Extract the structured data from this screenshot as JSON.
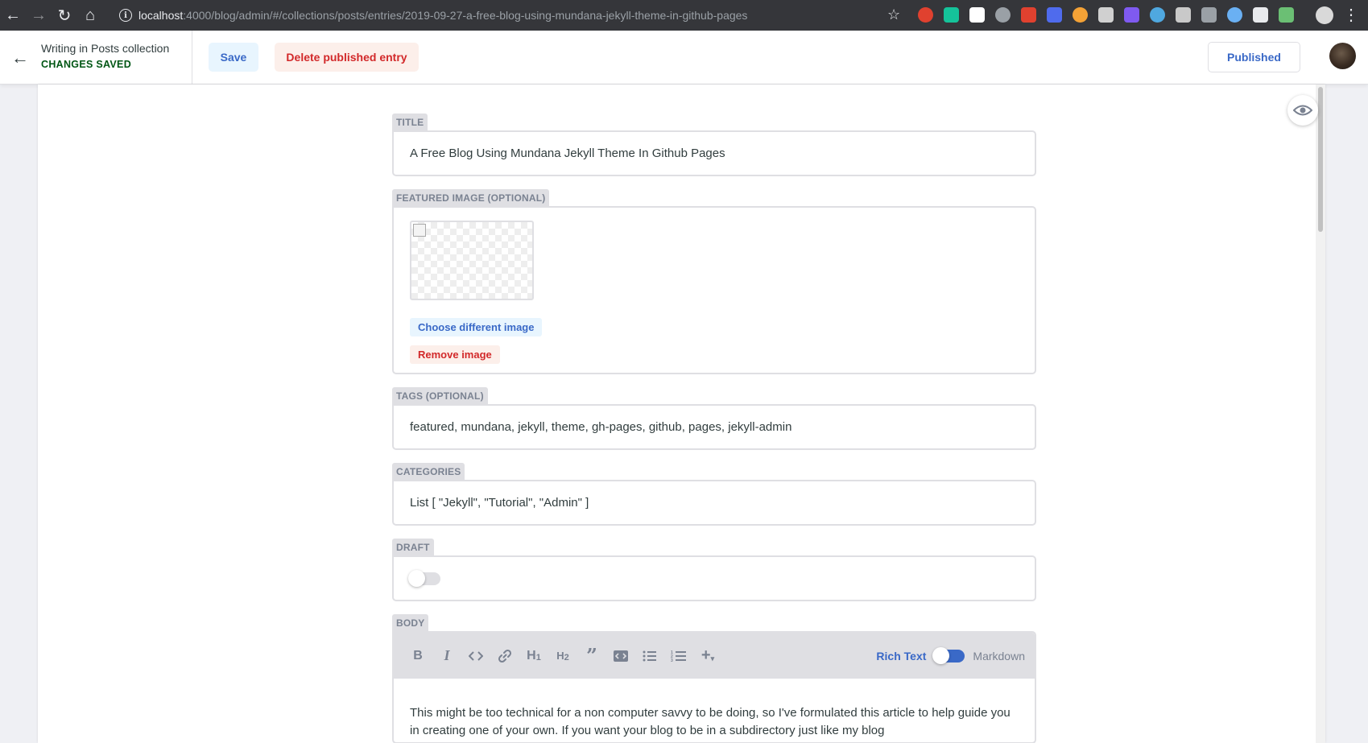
{
  "browser": {
    "url_host": "localhost",
    "url_path": ":4000/blog/admin/#/collections/posts/entries/2019-09-27-a-free-blog-using-mundana-jekyll-theme-in-github-pages",
    "extension_colors": [
      "#e0412f",
      "#15c39a",
      "#ffffff",
      "#9aa0a6",
      "#e0412f",
      "#4f6bed",
      "#f4a236",
      "#d0d0d0",
      "#7f5af0",
      "#4fa8e0",
      "#c9c9c9",
      "#9aa0a6",
      "#6ab0f3",
      "#e8eaed",
      "#6bbf74"
    ]
  },
  "header": {
    "status_title": "Writing in Posts collection",
    "status_saved": "CHANGES SAVED",
    "save_label": "Save",
    "delete_label": "Delete published entry",
    "published_label": "Published"
  },
  "fields": {
    "title": {
      "label": "TITLE",
      "value": "A Free Blog Using Mundana Jekyll Theme In Github Pages"
    },
    "image": {
      "label": "FEATURED IMAGE (OPTIONAL)",
      "choose_label": "Choose different image",
      "remove_label": "Remove image"
    },
    "tags": {
      "label": "TAGS (OPTIONAL)",
      "value": "featured, mundana, jekyll, theme, gh-pages, github, pages, jekyll-admin"
    },
    "categories": {
      "label": "CATEGORIES",
      "value": "List [ \"Jekyll\", \"Tutorial\", \"Admin\" ]"
    },
    "draft": {
      "label": "DRAFT",
      "on": false
    },
    "body": {
      "label": "BODY",
      "mode_rich": "Rich Text",
      "mode_markdown": "Markdown",
      "toolbar": [
        "bold",
        "italic",
        "code",
        "link",
        "heading-one",
        "heading-two",
        "quote",
        "code-block",
        "bulleted-list",
        "numbered-list",
        "add"
      ],
      "text": "This might be too technical for a non computer savvy to be doing, so I've formulated this article to help guide you in creating one of your own. If you want your blog to be in a subdirectory just like my blog"
    }
  },
  "colors": {
    "accent": "#3a69c7",
    "danger": "#d2292a",
    "success": "#005614"
  }
}
